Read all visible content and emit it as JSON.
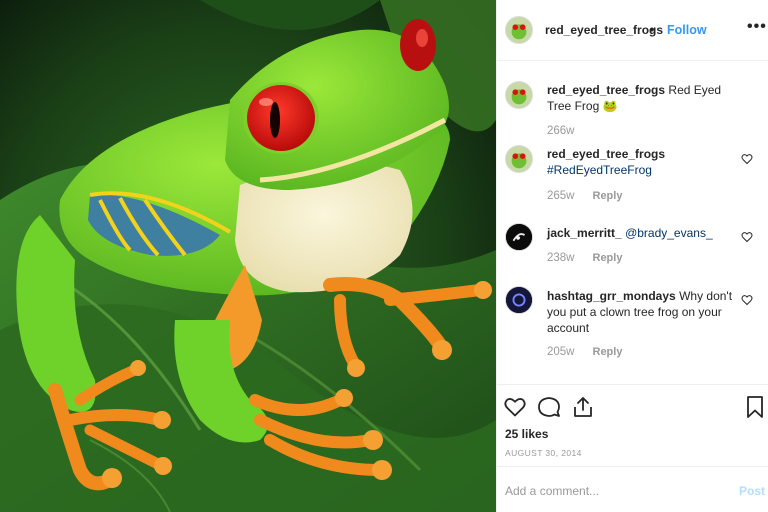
{
  "post": {
    "username": "red_eyed_tree_frogs",
    "separator": "•",
    "follow_label": "Follow",
    "more_label": "•••"
  },
  "comments": [
    {
      "username": "red_eyed_tree_frogs",
      "text": "Red Eyed Tree Frog 🐸",
      "time": "266w",
      "reply": ""
    },
    {
      "username": "red_eyed_tree_frogs",
      "text": "#RedEyedTreeFrog",
      "time": "265w",
      "reply": "Reply"
    },
    {
      "username": "jack_merritt_",
      "text": "@brady_evans_",
      "time": "238w",
      "reply": "Reply"
    },
    {
      "username": "hashtag_grr_mondays",
      "text": "Why don't you put a clown tree frog on your account",
      "time": "205w",
      "reply": "Reply"
    }
  ],
  "actions": {
    "likes": "25 likes",
    "date": "AUGUST 30, 2014"
  },
  "add_comment": {
    "placeholder": "Add a comment...",
    "post_label": "Post"
  },
  "colors": {
    "link_blue": "#3897f0",
    "hashtag_blue": "#003569",
    "muted_gray": "#999999",
    "post_disabled": "#b2dffc"
  },
  "icons": [
    "heart-icon",
    "comment-icon",
    "share-icon",
    "bookmark-icon",
    "more-icon"
  ]
}
